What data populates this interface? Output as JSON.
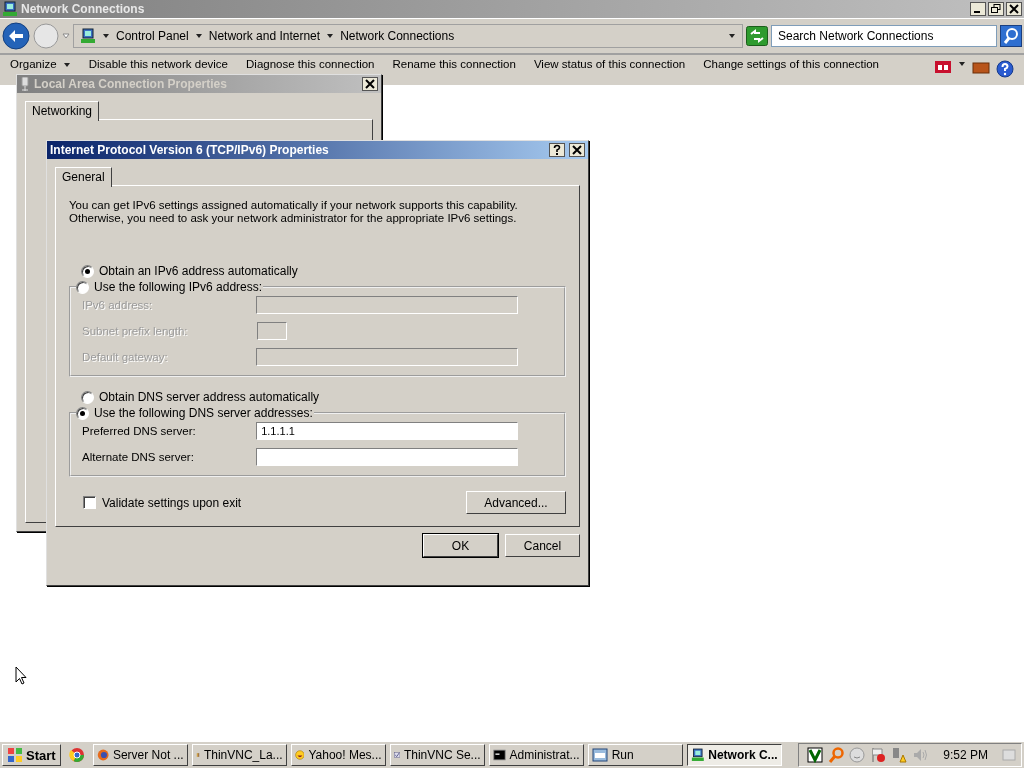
{
  "window": {
    "title": "Network Connections"
  },
  "address_bar": {
    "breadcrumbs": [
      "Control Panel",
      "Network and Internet",
      "Network Connections"
    ]
  },
  "search": {
    "placeholder": "Search Network Connections"
  },
  "command_bar": {
    "items": [
      {
        "label": "Organize",
        "dropdown": true
      },
      {
        "label": "Disable this network device",
        "dropdown": false
      },
      {
        "label": "Diagnose this connection",
        "dropdown": false
      },
      {
        "label": "Rename this connection",
        "dropdown": false
      },
      {
        "label": "View status of this connection",
        "dropdown": false
      },
      {
        "label": "Change settings of this connection",
        "dropdown": false
      }
    ]
  },
  "connection_dialog": {
    "title": "Local Area Connection Properties",
    "tabs": [
      {
        "label": "Networking",
        "selected": true
      }
    ]
  },
  "ipv6_dialog": {
    "title": "Internet Protocol Version 6 (TCP/IPv6) Properties",
    "tabs": [
      {
        "label": "General",
        "selected": true
      }
    ],
    "description": "You can get IPv6 settings assigned automatically if your network supports this capability.\nOtherwise, you need to ask your network administrator for the appropriate IPv6 settings.",
    "address_options": [
      {
        "label": "Obtain an IPv6 address automatically",
        "selected": true
      },
      {
        "label": "Use the following IPv6 address:",
        "selected": false
      }
    ],
    "address_fields": [
      {
        "label": "IPv6 address:",
        "disabled": true,
        "kind": "address"
      },
      {
        "label": "Subnet prefix length:",
        "disabled": true,
        "kind": "prefix"
      },
      {
        "label": "Default gateway:",
        "disabled": true,
        "kind": "address"
      }
    ],
    "dns_options": [
      {
        "label": "Obtain DNS server address automatically",
        "selected": false
      },
      {
        "label": "Use the following DNS server addresses:",
        "selected": true
      }
    ],
    "dns_fields": [
      {
        "label": "Preferred DNS server:",
        "value": "1.1.1.1",
        "disabled": false,
        "kind": "address"
      },
      {
        "label": "Alternate DNS server:",
        "disabled": false,
        "kind": "address"
      }
    ],
    "validate": {
      "label": "Validate settings upon exit",
      "checked": false
    },
    "advanced_button": "Advanced...",
    "buttons": [
      {
        "label": "OK",
        "default": true
      },
      {
        "label": "Cancel",
        "default": false
      }
    ]
  },
  "taskbar": {
    "start": "Start",
    "tasks": [
      {
        "label": "Server Not ...",
        "active": false
      },
      {
        "label": "ThinVNC_La...",
        "active": false
      },
      {
        "label": "Yahoo! Mes...",
        "active": false
      },
      {
        "label": "ThinVNC Se...",
        "active": false
      },
      {
        "label": "Administrat...",
        "active": false
      },
      {
        "label": "Run",
        "active": false
      },
      {
        "label": "Network C...",
        "active": true
      }
    ],
    "clock": "9:52 PM"
  }
}
